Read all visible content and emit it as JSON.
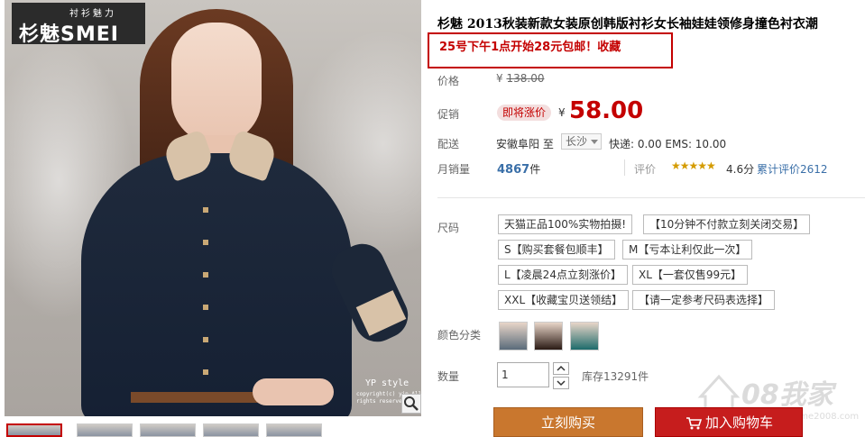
{
  "brand": {
    "logo_top": "衬衫魅力",
    "logo_main": "杉魅SMEI",
    "watermark": "YP  style",
    "watermark_small": "copyright(c) yip All rights reserved"
  },
  "product": {
    "title": "杉魅 2013秋装新款女装原创韩版衬衫女长袖娃娃领修身撞色衬衣潮",
    "promo": "25号下午1点开始28元包邮！收藏"
  },
  "price": {
    "label": "价格",
    "old_currency": "¥",
    "old_value": "138.00",
    "promo_label": "促销",
    "badge": "即将涨价",
    "currency": "¥",
    "value": "58.00"
  },
  "shipping": {
    "label": "配送",
    "from": "安徽阜阳 至",
    "to": "长沙",
    "fee": "快递: 0.00 EMS: 10.00"
  },
  "sales": {
    "label": "月销量",
    "count": "4867",
    "unit": "件",
    "rating_label": "评价",
    "stars": "★★★★★",
    "score": "4.6分",
    "reviews": "累计评价2612"
  },
  "sizes": {
    "label": "尺码",
    "options": [
      "天猫正品100%实物拍摄!",
      "【10分钟不付款立刻关闭交易】",
      "S【购买套餐包顺丰】",
      "M【亏本让利仅此一次】",
      "L【凌晨24点立刻涨价】",
      "XL【一套仅售99元】",
      "XXL【收藏宝贝送领结】",
      "【请一定参考尺码表选择】"
    ]
  },
  "colors": {
    "label": "颜色分类"
  },
  "quantity": {
    "label": "数量",
    "value": "1",
    "stock": "库存13291件"
  },
  "actions": {
    "buy": "立刻购买",
    "cart": "加入购物车"
  },
  "site_watermark": {
    "text": "08我家",
    "url": "www.home2008.com"
  },
  "colors_accent": {
    "price_red": "#c40000",
    "buy_orange": "#c9772e",
    "cart_red": "#c61d1d",
    "link_blue": "#3a6fa8"
  }
}
